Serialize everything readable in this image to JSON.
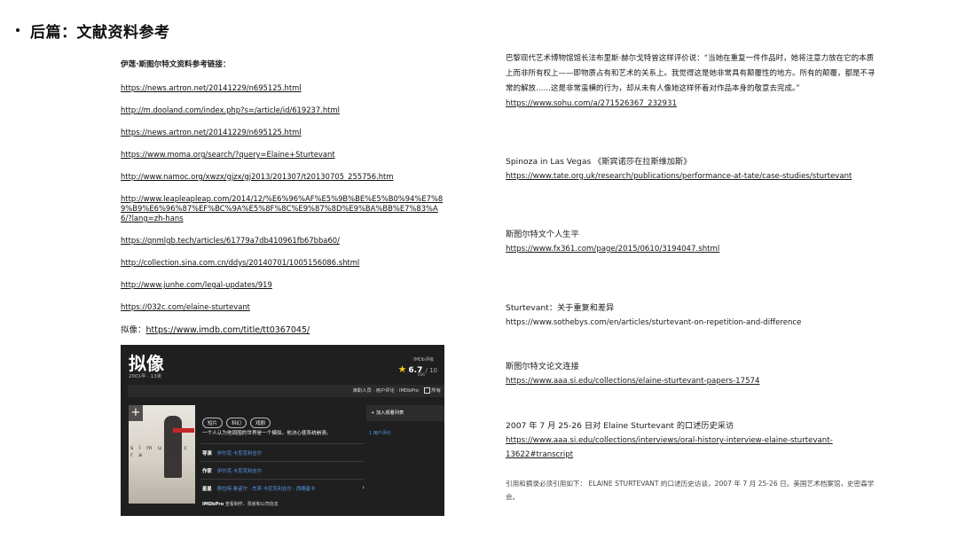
{
  "title": "后篇：文献资料参考",
  "left": {
    "heading": "伊莲·斯图尔特文资料参考链接：",
    "links": [
      "https://news.artron.net/20141229/n695125.html",
      "http://m.dooland.com/index.php?s=/article/id/619237.html",
      "https://news.artron.net/20141229/n695125.html",
      "https://www.moma.org/search/?query=Elaine+Sturtevant",
      "http://www.namoc.org/xwzx/gjzx/gj2013/201307/t20130705_255756.htm",
      "http://www.leapleapleap.com/2014/12/%E6%96%AF%E5%9B%BE%E5%B0%94%E7%89%B9%E6%96%87%EF%BC%9A%E5%8F%8C%E9%87%8D%E9%BA%BB%E7%83%A6/?lang=zh-hans",
      "https://qnmlgb.tech/articles/61779a7db410961fb67bba60/",
      "http://collection.sina.com.cn/ddys/20140701/1005156086.shtml",
      "http://www.junhe.com/legal-updates/919",
      "https://032c.com/elaine-sturtevant"
    ],
    "imdb_prefix": "拟像：",
    "imdb_link": "https://www.imdb.com/title/tt0367045/"
  },
  "imdb_card": {
    "title": "拟像",
    "meta": "2001年 · 13米",
    "rating_label": "IMDb评级",
    "rating": "6.7",
    "rating_of": "/ 10",
    "votes": "166",
    "nav": "演职人员 · 用户评论 · IMDbPro",
    "nav_all": "所有",
    "poster_word": "s i m u l a c r a",
    "genres": [
      "短片",
      "科幻",
      "戏剧"
    ],
    "plot": "一个人认为他周围的世界是一个模拟。他决心使系统崩溃。",
    "crew": [
      {
        "role": "导演",
        "names": "伊尔克·卡尼克利吉尔"
      },
      {
        "role": "作家",
        "names": "伊尔克·卡尼克利吉尔"
      },
      {
        "role": "星星",
        "names": "穆拉特·奥诺尔 · 杰滨·卡尼克利吉尔 · 西略星卡"
      }
    ],
    "watchlist": "加入观看列表",
    "user_reviews": "1 用户评价",
    "imdbpro_brand": "IMDbPro",
    "imdbpro_text": "查看制作、票房和公司信息"
  },
  "right": {
    "quote": "巴黎现代艺术博物馆馆长法布里斯·赫尔戈特曾这样评价说：“当她在重复一件作品时，她将注意力放在它的本质上而非所有权上——即物质占有和艺术的关系上。我觉得这是她非常具有颠覆性的地方。所有的颠覆，都是不寻常的解放……这是非常蛮横的行为，却从未有人像她这样怀着对作品本身的敬意去完成。”",
    "quote_link": "https://www.sohu.com/a/271526367_232931",
    "spinoza_title": "Spinoza in Las Vegas 《斯宾诺莎在拉斯维加斯》",
    "spinoza_link": "https://www.tate.org.uk/research/publications/performance-at-tate/case-studies/sturtevant",
    "bio_title": "斯图尔特文个人生平",
    "bio_link": "https://www.fx361.com/page/2015/0610/3194047.shtml",
    "sothebys_title": "Sturtevant：关于重复和差异",
    "sothebys_link": "https://www.sothebys.com/en/articles/sturtevant-on-repetition-and-difference",
    "papers_title": "斯图尔特文论文连接",
    "papers_link": "https://www.aaa.si.edu/collections/elaine-sturtevant-papers-17574",
    "oral_title": "2007 年 7 月 25-26 日对 Elaine Sturtevant 的口述历史采访",
    "oral_link": "https://www.aaa.si.edu/collections/interviews/oral-history-interview-elaine-sturtevant-13622#transcript",
    "citation": "引用和摘录必须引用如下： ELAINE STURTEVANT 的口述历史访谈，2007 年 7 月 25-26 日。美国艺术档案馆，史密森学会。"
  }
}
